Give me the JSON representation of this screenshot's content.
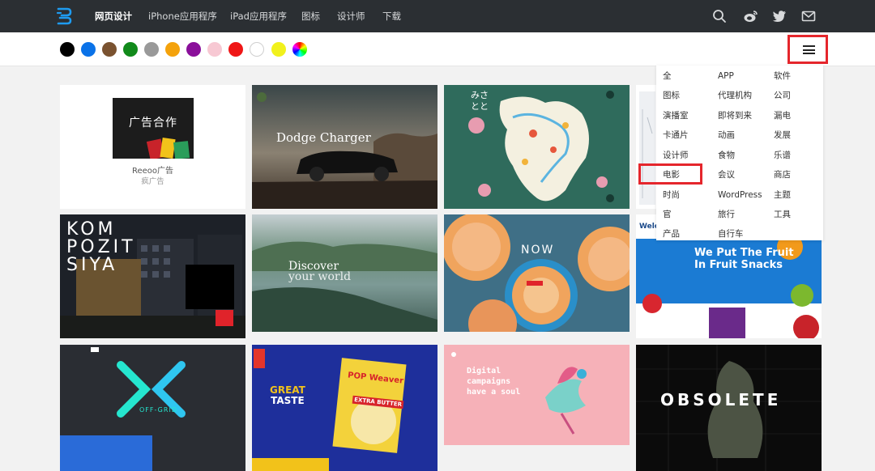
{
  "nav": {
    "items": [
      {
        "label": "网页设计",
        "active": true
      },
      {
        "label": "iPhone应用程序",
        "active": false
      },
      {
        "label": "iPad应用程序",
        "active": false
      },
      {
        "label": "图标",
        "active": false
      },
      {
        "label": "设计师",
        "active": false
      },
      {
        "label": "下载",
        "active": false
      }
    ],
    "icons": [
      "search-icon",
      "weibo-icon",
      "twitter-icon",
      "mail-icon"
    ]
  },
  "colors": [
    "#000000",
    "#0a72e8",
    "#7a5230",
    "#118a1b",
    "#999999",
    "#f4a20b",
    "#8a0f9a",
    "#f7c8d3",
    "#ef1616",
    "#ffffff",
    "#f1f11c",
    "rainbow"
  ],
  "menu_icon": "hamburger-icon",
  "ad": {
    "image_title": "广告合作",
    "name": "Reeoo广告",
    "sub": "疯广告"
  },
  "cards": {
    "dodge_title": "Dodge Charger",
    "discover_line1": "Discover",
    "discover_line2": "your world",
    "now_text": "NOW",
    "welch_line1": "We Put The Fruit",
    "welch_line2": "In Fruit Snacks",
    "welch_brand": "Welch's",
    "great_taste_1": "GREAT",
    "great_taste_2": "TASTE",
    "pop_brand": "POP Weaver",
    "pop_sub": "EXTRA BUTTER",
    "digital_1": "Digital",
    "digital_2": "campaigns",
    "digital_3": "have a soul",
    "obsolete": "OBSOLETE",
    "offgrid": "OFF-GRID",
    "kompo_1": "KOM",
    "kompo_2": "POZIT",
    "kompo_3": "SIYA"
  },
  "dropdown": {
    "items": [
      [
        "全",
        "APP",
        "软件"
      ],
      [
        "图标",
        "代理机构",
        "公司"
      ],
      [
        "演播室",
        "即将到来",
        "漏电"
      ],
      [
        "卡通片",
        "动画",
        "发展"
      ],
      [
        "设计师",
        "食物",
        "乐谱"
      ],
      [
        "电影",
        "会议",
        "商店"
      ],
      [
        "时尚",
        "WordPress",
        "主题"
      ],
      [
        "官",
        "旅行",
        "工具"
      ],
      [
        "产品",
        "自行车",
        ""
      ]
    ],
    "highlighted": "电影"
  }
}
